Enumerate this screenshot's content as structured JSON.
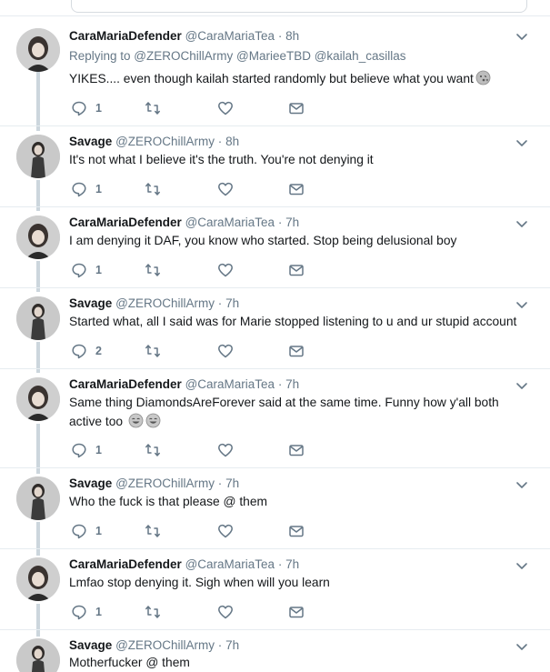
{
  "colors": {
    "name": "#14171a",
    "secondary": "#657786",
    "thread_line": "#ccd6dd",
    "separator": "#e6ecf0"
  },
  "icons": {
    "reply": "reply-icon",
    "retweet": "retweet-icon",
    "like": "heart-icon",
    "message": "envelope-icon",
    "menu": "chevron-down-icon"
  },
  "tweets": [
    {
      "name": "CaraMariaDefender",
      "handle": "@CaraMariaTea",
      "dot": "·",
      "time": "8h",
      "replying_to": "Replying to @ZEROChillArmy @MarieeTBD @kailah_casillas",
      "text": "YIKES.... even though kailah started randomly but believe what you want",
      "emoji": "face-with-kiss-emoji",
      "reply_count": "1"
    },
    {
      "name": "Savage",
      "handle": "@ZEROChillArmy",
      "dot": "·",
      "time": "8h",
      "text": "It's not what I believe it's the truth. You're not denying it",
      "reply_count": "1"
    },
    {
      "name": "CaraMariaDefender",
      "handle": "@CaraMariaTea",
      "dot": "·",
      "time": "7h",
      "text": "I am denying it DAF, you know who started. Stop being delusional boy",
      "reply_count": "1"
    },
    {
      "name": "Savage",
      "handle": "@ZEROChillArmy",
      "dot": "·",
      "time": "7h",
      "text": "Started what, all I said was for Marie stopped listening to u and ur stupid account",
      "reply_count": "2"
    },
    {
      "name": "CaraMariaDefender",
      "handle": "@CaraMariaTea",
      "dot": "·",
      "time": "7h",
      "text_line1": "Same thing DiamondsAreForever said at the same time. Funny how y'all both",
      "text_line2": "active too",
      "emoji": "tears-of-joy-emoji",
      "reply_count": "1"
    },
    {
      "name": "Savage",
      "handle": "@ZEROChillArmy",
      "dot": "·",
      "time": "7h",
      "text": "Who the fuck is that please @ them",
      "reply_count": "1"
    },
    {
      "name": "CaraMariaDefender",
      "handle": "@CaraMariaTea",
      "dot": "·",
      "time": "7h",
      "text": "Lmfao stop denying it. Sigh when will you learn",
      "reply_count": "1"
    },
    {
      "name": "Savage",
      "handle": "@ZEROChillArmy",
      "dot": "·",
      "time": "7h",
      "text": "Motherfucker @ them"
    }
  ]
}
